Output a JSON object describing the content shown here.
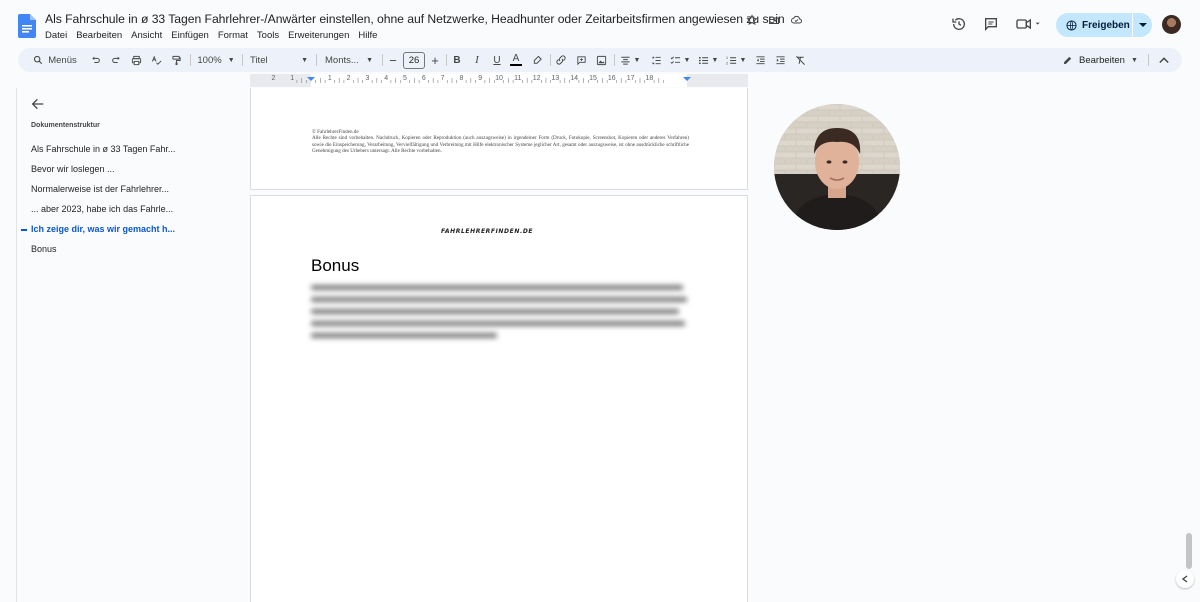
{
  "document": {
    "title": "Als Fahrschule in ø 33 Tagen Fahrlehrer-/Anwärter einstellen, ohne auf Netzwerke, Headhunter oder Zeitarbeitsfirmen angewiesen zu sein"
  },
  "menu": {
    "items": [
      "Datei",
      "Bearbeiten",
      "Ansicht",
      "Einfügen",
      "Format",
      "Tools",
      "Erweiterungen",
      "Hilfe"
    ]
  },
  "header_actions": {
    "share_label": "Freigeben"
  },
  "toolbar": {
    "search_label": "Menüs",
    "zoom": "100%",
    "style": "Titel",
    "font": "Monts...",
    "font_size": "26",
    "mode_label": "Bearbeiten"
  },
  "ruler": {
    "labels": [
      "2",
      "1",
      "1",
      "2",
      "3",
      "4",
      "5",
      "6",
      "7",
      "8",
      "9",
      "10",
      "11",
      "12",
      "13",
      "14",
      "15",
      "16",
      "17",
      "18"
    ]
  },
  "outline": {
    "heading": "Dokumentenstruktur",
    "items": [
      {
        "label": "Als Fahrschule in ø 33 Tagen Fahr...",
        "active": false
      },
      {
        "label": "Bevor wir loslegen ...",
        "active": false
      },
      {
        "label": "Normalerweise ist der Fahrlehrer...",
        "active": false
      },
      {
        "label": "... aber 2023, habe ich das Fahrle...",
        "active": false
      },
      {
        "label": "Ich zeige dir, was wir gemacht h...",
        "active": true
      },
      {
        "label": "Bonus",
        "active": false
      }
    ]
  },
  "page1": {
    "footer_lines": [
      "© FahrlehrerFinden.de",
      "Alle Rechte sind vorbehalten. Nachdruck, Kopieren oder Reproduktion (auch auszugsweise) in irgendeiner Form (Druck, Fotokopie, Screenshot, Kopieren oder anderes Verfahren) sowie die Einspeicherung, Verarbeitung, Vervielfältigung und Verbreitung mit Hilfe elektronischer Systeme jeglicher Art, gesamt oder auszugsweise, ist ohne ausdrückliche schriftliche Genehmigung des Urhebers untersagt. Alle Rechte vorbehalten."
    ]
  },
  "page2": {
    "header_logo": "FahrlehrerFinden.de",
    "heading": "Bonus"
  },
  "colors": {
    "accent": "#0b57d0",
    "share_bg": "#c2e7ff",
    "toolbar_bg": "#edf2fa",
    "app_bg": "#f9fbfd"
  }
}
